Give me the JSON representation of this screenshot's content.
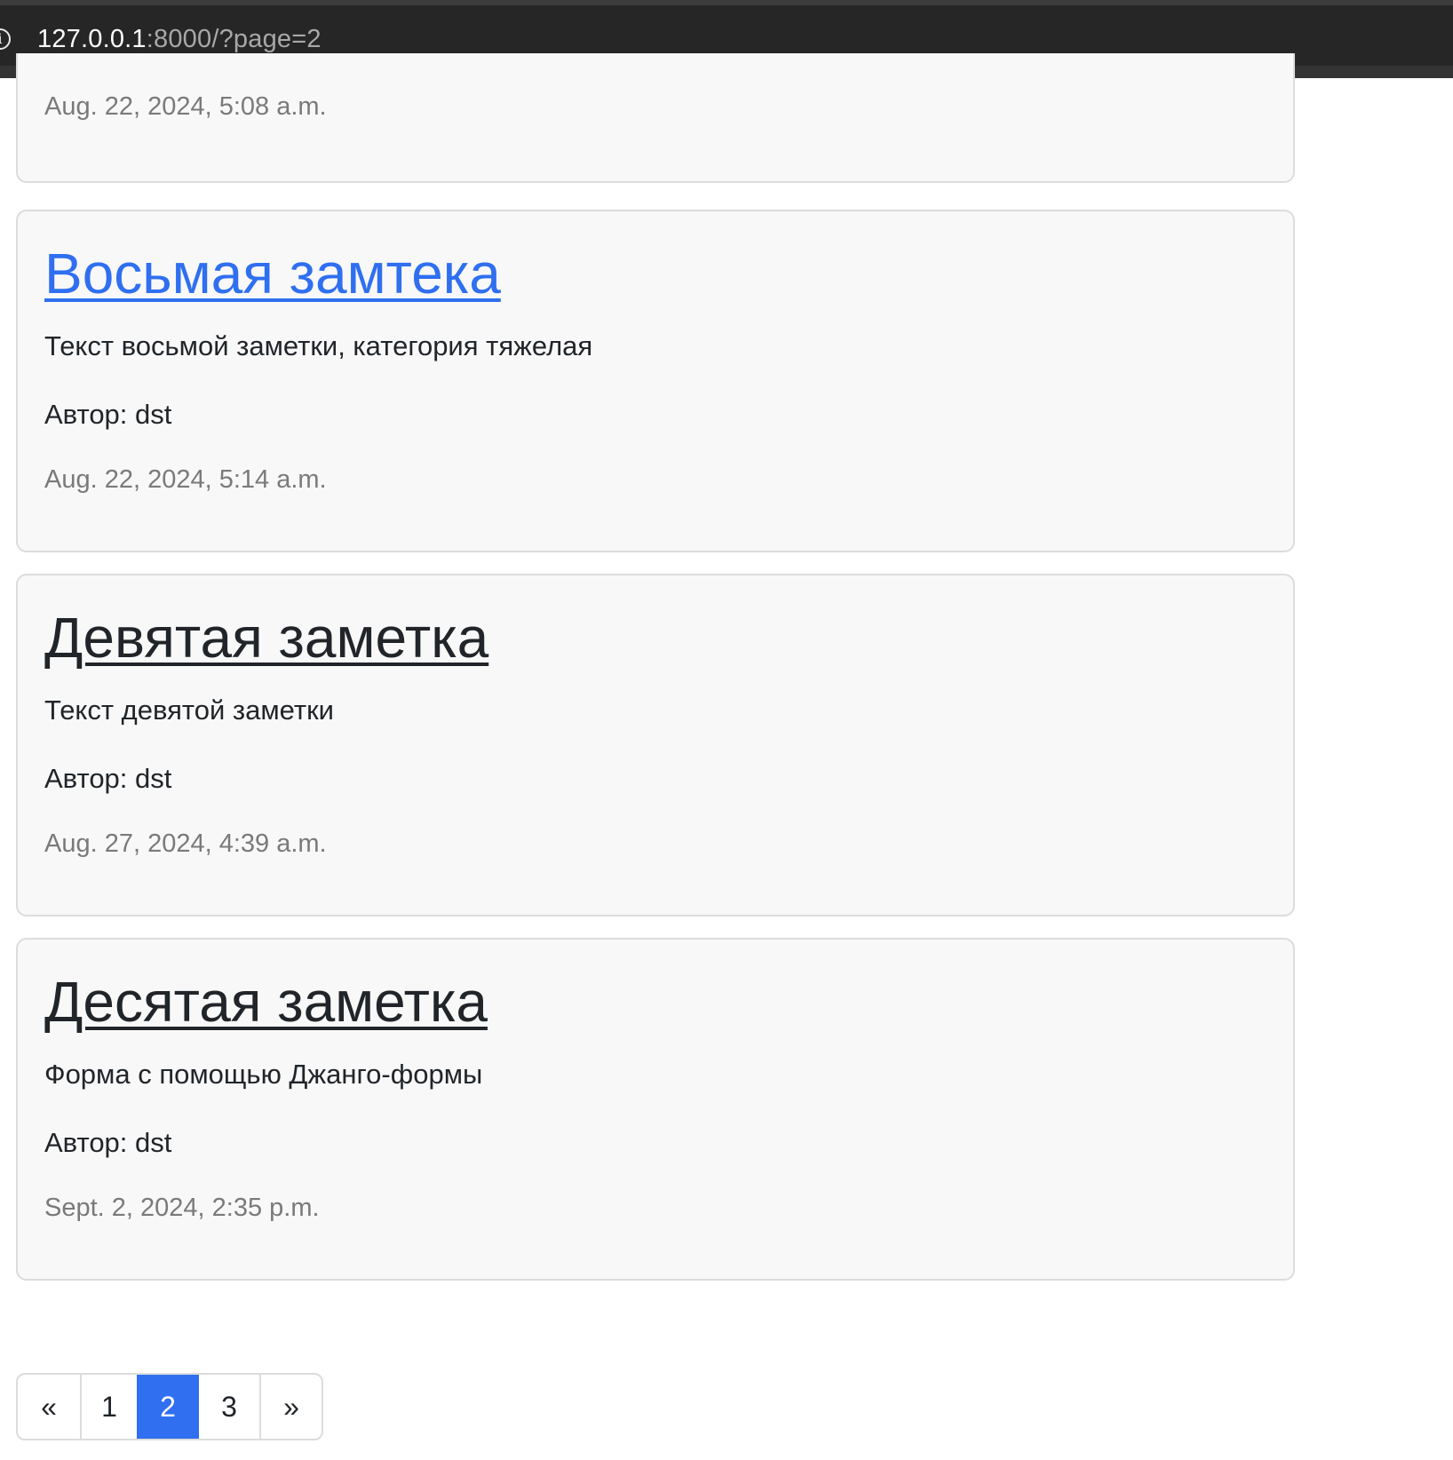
{
  "browser": {
    "url_host": "127.0.0.1",
    "url_rest": ":8000/?page=2",
    "info_icon": "info-icon"
  },
  "notes": [
    {
      "date": "Aug. 22, 2024, 5:08 a.m."
    },
    {
      "title": "Восьмая замтека",
      "text": "Текст восьмой заметки, категория тяжелая",
      "author": "Автор: dst",
      "date": "Aug. 22, 2024, 5:14 a.m."
    },
    {
      "title": "Девятая заметка",
      "text": "Текст девятой заметки",
      "author": "Автор: dst",
      "date": "Aug. 27, 2024, 4:39 a.m."
    },
    {
      "title": "Десятая заметка",
      "text": "Форма с помощью Джанго-формы",
      "author": "Автор: dst",
      "date": "Sept. 2, 2024, 2:35 p.m."
    }
  ],
  "pagination": {
    "prev": "«",
    "pages": [
      "1",
      "2",
      "3"
    ],
    "current": "2",
    "next": "»"
  },
  "colors": {
    "link_active": "#2f6ff0",
    "text": "#212529",
    "muted": "#7a7a7a",
    "card_bg": "#f8f8f8",
    "card_border": "#dcdcdc"
  }
}
